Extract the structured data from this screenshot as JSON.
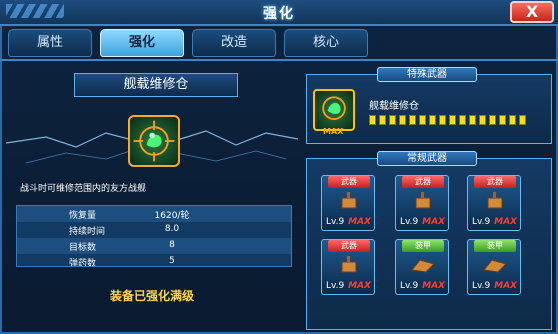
{
  "header": {
    "title": "强化",
    "close_label": "X"
  },
  "tabs": [
    {
      "label": "属性",
      "active": false
    },
    {
      "label": "强化",
      "active": true
    },
    {
      "label": "改造",
      "active": false
    },
    {
      "label": "核心",
      "active": false
    }
  ],
  "item": {
    "name": "舰载维修仓",
    "icon": "repair-bay-icon",
    "description": "战斗时可维修范围内的友方战舰"
  },
  "stats": [
    {
      "label": "恢复量",
      "value": "1620/轮"
    },
    {
      "label": "持续时间",
      "value": "8.0"
    },
    {
      "label": "目标数",
      "value": "8"
    },
    {
      "label": "弹药数",
      "value": "5"
    }
  ],
  "status_message": "装备已强化满级",
  "special_weapons": {
    "header": "特殊武器",
    "name": "舰载维修仓",
    "badge": "MAX",
    "level_segments": 16,
    "level_filled": 16
  },
  "regular_weapons": {
    "header": "常规武器",
    "cards": [
      {
        "type": "武器",
        "kind": "weapon",
        "level": "Lv.9",
        "max": "MAX",
        "icon": "turret-icon"
      },
      {
        "type": "武器",
        "kind": "weapon",
        "level": "Lv.9",
        "max": "MAX",
        "icon": "turret-icon"
      },
      {
        "type": "武器",
        "kind": "weapon",
        "level": "Lv.9",
        "max": "MAX",
        "icon": "turret-icon"
      },
      {
        "type": "武器",
        "kind": "weapon",
        "level": "Lv.9",
        "max": "MAX",
        "icon": "gun-icon"
      },
      {
        "type": "装甲",
        "kind": "armor",
        "level": "Lv.9",
        "max": "MAX",
        "icon": "armor-plate-icon"
      },
      {
        "type": "装甲",
        "kind": "armor",
        "level": "Lv.9",
        "max": "MAX",
        "icon": "armor-plate-icon"
      }
    ]
  },
  "colors": {
    "accent": "#3f86c8",
    "highlight": "#ffd54a",
    "weapon_badge": "#c62020",
    "armor_badge": "#3a9b22",
    "max_text": "#ff3d2e"
  }
}
